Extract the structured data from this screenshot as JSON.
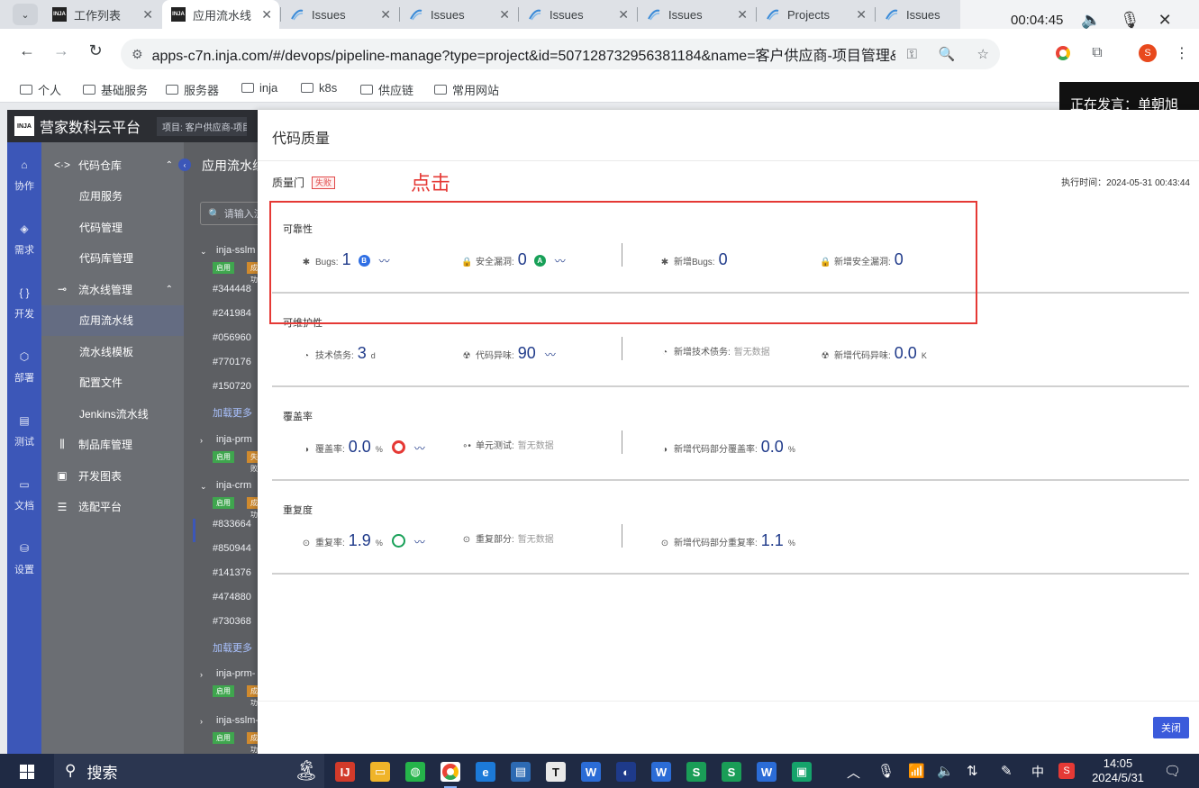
{
  "browser": {
    "tabs": [
      {
        "title": "工作列表",
        "icon": "inja"
      },
      {
        "title": "应用流水线",
        "icon": "inja"
      },
      {
        "title": "Issues",
        "icon": "jira"
      },
      {
        "title": "Issues",
        "icon": "jira"
      },
      {
        "title": "Issues",
        "icon": "jira"
      },
      {
        "title": "Issues",
        "icon": "jira"
      },
      {
        "title": "Projects",
        "icon": "jira"
      },
      {
        "title": "Issues",
        "icon": "jira"
      }
    ],
    "url": "apps-c7n.inja.com/#/devops/pipeline-manage?type=project&id=507128732956381184&name=客户供应商-项目管理&cat...",
    "bookmarks": [
      "个人",
      "基础服务",
      "服务器",
      "inja",
      "k8s",
      "供应链",
      "常用网站"
    ],
    "profile_initial": "S"
  },
  "recorder": {
    "time": "00:04:45"
  },
  "speaker_banner": "正在发言：单朝旭",
  "app": {
    "logo": "INJA",
    "title": "营家数科云平台",
    "project": "项目: 客户供应商-项目管理"
  },
  "rail": [
    {
      "icon": "rocket-icon",
      "label": "协作"
    },
    {
      "icon": "layers-icon",
      "label": "需求"
    },
    {
      "icon": "code-icon",
      "label": "开发"
    },
    {
      "icon": "deploy-icon",
      "label": "部署"
    },
    {
      "icon": "test-icon",
      "label": "测试"
    },
    {
      "icon": "doc-icon",
      "label": "文档"
    },
    {
      "icon": "settings-icon",
      "label": "设置"
    }
  ],
  "sidebar": {
    "groups": [
      {
        "label": "代码仓库",
        "items": [
          "应用服务",
          "代码管理",
          "代码库管理"
        ]
      },
      {
        "label": "流水线管理",
        "items": [
          "应用流水线",
          "流水线模板",
          "配置文件",
          "Jenkins流水线"
        ]
      }
    ],
    "singles": [
      "制品库管理",
      "开发图表",
      "选配平台"
    ]
  },
  "middle": {
    "title": "应用流水线",
    "search_placeholder": "请输入流水线名称",
    "pipelines": [
      {
        "name": "inja-sslm",
        "runs": [
          "#344448",
          "#241984",
          "#056960",
          "#770176",
          "#150720"
        ]
      },
      {
        "name": "inja-prm",
        "runs": []
      },
      {
        "name": "inja-crm",
        "runs": [
          "#833664",
          "#850944",
          "#141376",
          "#474880",
          "#730368"
        ]
      },
      {
        "name": "inja-prm-",
        "runs": []
      },
      {
        "name": "inja-sslm-",
        "runs": []
      }
    ],
    "load_more": "加载更多",
    "tag_enabled": "启用",
    "tag_status": "成功",
    "tag_failed": "失败"
  },
  "drawer": {
    "title": "代码质量",
    "quality_gate_label": "质量门",
    "quality_gate_status": "失败",
    "exec_time": "执行时间：2024-05-31 00:43:44",
    "annotation": "点击",
    "close_label": "关闭",
    "sections": [
      {
        "title": "可靠性",
        "metrics": [
          {
            "icon": "bug-icon",
            "label": "Bugs:",
            "value": "1",
            "unit": "",
            "grade": "B",
            "grade_color": "#2f6fe4",
            "trend": true
          },
          {
            "icon": "lock-icon",
            "label": "安全漏洞:",
            "value": "0",
            "unit": "",
            "grade": "A",
            "grade_color": "#18a058",
            "trend": true
          },
          {
            "icon": "bug-icon",
            "label": "新增Bugs:",
            "value": "0",
            "unit": ""
          },
          {
            "icon": "lock-icon",
            "label": "新增安全漏洞:",
            "value": "0",
            "unit": ""
          }
        ]
      },
      {
        "title": "可维护性",
        "metrics": [
          {
            "icon": "debt-icon",
            "label": "技术债务:",
            "value": "3",
            "unit": "d"
          },
          {
            "icon": "smell-icon",
            "label": "代码异味:",
            "value": "90",
            "unit": "",
            "trend": true
          },
          {
            "icon": "debt-icon",
            "label": "新增技术债务:",
            "novalue": "暂无数据"
          },
          {
            "icon": "smell-icon",
            "label": "新增代码异味:",
            "value": "0.0",
            "unit": "K"
          }
        ]
      },
      {
        "title": "覆盖率",
        "metrics": [
          {
            "icon": "coverage-icon",
            "label": "覆盖率:",
            "value": "0.0",
            "unit": "%",
            "ring": "#e53935",
            "trend": true
          },
          {
            "icon": "unit-test-icon",
            "label": "单元测试:",
            "novalue": "暂无数据"
          },
          {
            "icon": "coverage-icon",
            "label": "新增代码部分覆盖率:",
            "value": "0.0",
            "unit": "%"
          }
        ]
      },
      {
        "title": "重复度",
        "metrics": [
          {
            "icon": "duplicate-icon",
            "label": "重复率:",
            "value": "1.9",
            "unit": "%",
            "ring": "#18a058",
            "trend": true
          },
          {
            "icon": "duplicate-icon",
            "label": "重复部分:",
            "novalue": "暂无数据"
          },
          {
            "icon": "duplicate-icon",
            "label": "新增代码部分重复率:",
            "value": "1.1",
            "unit": "%"
          }
        ]
      }
    ]
  },
  "taskbar": {
    "search_label": "搜索",
    "ime": "中",
    "time": "14:05",
    "date": "2024/5/31"
  }
}
